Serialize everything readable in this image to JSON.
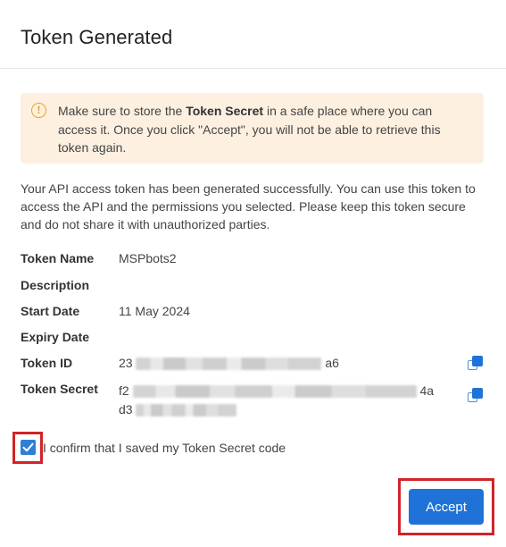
{
  "dialog": {
    "title": "Token Generated"
  },
  "warning": {
    "icon": "exclamation-circle-icon",
    "text_before": "Make sure to store the ",
    "text_bold": "Token Secret",
    "text_after": " in a safe place where you can access it. Once you click \"Accept\", you will not be able to retrieve this token again."
  },
  "intro": "Your API access token has been generated successfully. You can use this token to access the API and the permissions you selected. Please keep this token secure and do not share it with unauthorized parties.",
  "fields": {
    "token_name": {
      "label": "Token Name",
      "value": "MSPbots2"
    },
    "description": {
      "label": "Description",
      "value": ""
    },
    "start_date": {
      "label": "Start Date",
      "value": "11 May 2024"
    },
    "expiry_date": {
      "label": "Expiry Date",
      "value": ""
    },
    "token_id": {
      "label": "Token ID",
      "prefix": "23",
      "suffix": "a6"
    },
    "token_secret": {
      "label": "Token Secret",
      "line1_prefix": "f2",
      "line1_suffix": "4a",
      "line2_prefix": "d3"
    }
  },
  "confirm": {
    "label": "I confirm that I saved my Token Secret code",
    "checked": true
  },
  "actions": {
    "accept_label": "Accept"
  },
  "colors": {
    "accent": "#1f73d8",
    "warning_bg": "#fdf0e1",
    "warning_icon": "#e8a32a",
    "highlight": "#d2232a"
  }
}
